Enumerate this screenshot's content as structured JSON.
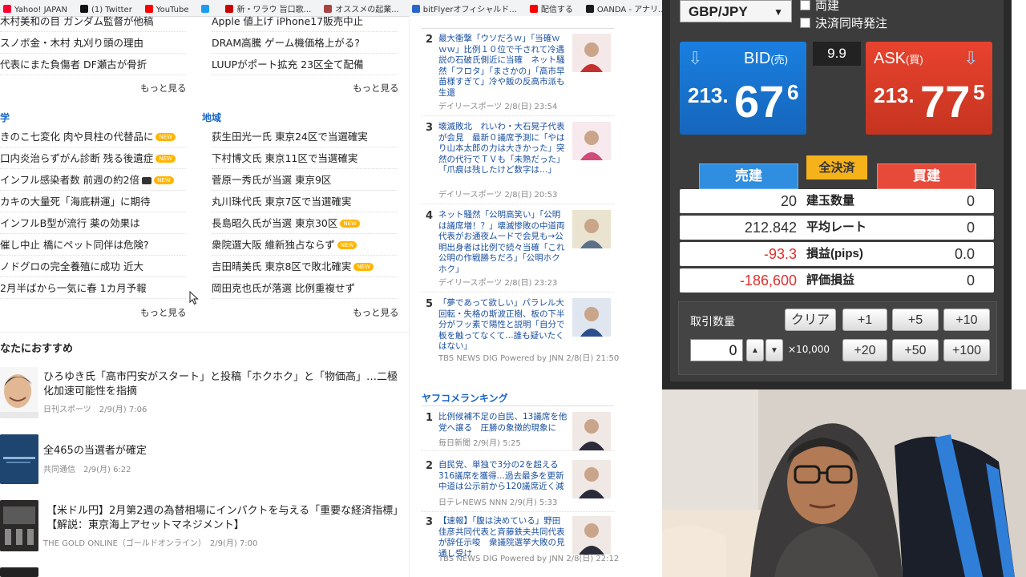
{
  "bookmarks": [
    {
      "label": "Yahoo! JAPAN",
      "color": "#ff0033"
    },
    {
      "label": "(1) Twitter",
      "color": "#111111"
    },
    {
      "label": "YouTube",
      "color": "#ff0000"
    },
    {
      "label": "",
      "color": "#1d9bf0"
    },
    {
      "label": "新・ワラウ 旨口歌...",
      "color": "#cc0000"
    },
    {
      "label": "オススメの起業...",
      "color": "#aa4444"
    },
    {
      "label": "bitFlyerオフィシャルド...",
      "color": "#2a66c8"
    },
    {
      "label": "配信する",
      "color": "#ff0000"
    },
    {
      "label": "OANDA - アナリ...",
      "color": "#1a1a1a"
    }
  ],
  "news_left": {
    "top_items": [
      "木村美和の目 ガンダム監督が他稿",
      "スノボ金・木村 丸刈り頭の理由",
      "代表にまた負傷者 DF瀬古が骨折"
    ],
    "more": "もっと見る",
    "section_title": "学",
    "items": [
      {
        "text": "きのこ七変化 肉や貝柱の代替品に",
        "badge": "NEW",
        "video": false
      },
      {
        "text": "口内炎治らずがん診断 残る後遺症",
        "badge": "NEW",
        "video": false
      },
      {
        "text": "インフル感染者数 前週の約2倍",
        "badge": "NEW",
        "video": true
      },
      {
        "text": "カキの大量死「海底耕運」に期待",
        "badge": "",
        "video": false
      },
      {
        "text": "インフルB型が流行 薬の効果は",
        "badge": "",
        "video": false
      },
      {
        "text": "催し中止 橋にペット同伴は危険?",
        "badge": "",
        "video": false
      },
      {
        "text": "ノドグロの完全養殖に成功 近大",
        "badge": "",
        "video": false
      },
      {
        "text": "2月半ばから一気に春 1カ月予報",
        "badge": "",
        "video": false
      }
    ]
  },
  "news_right": {
    "top_items": [
      "Apple 値上げ iPhone17販売中止",
      "DRAM高騰 ゲーム機価格上がる?",
      "LUUPがポート拡充 23区全て配備"
    ],
    "more": "もっと見る",
    "section_title": "地域",
    "items": [
      {
        "text": "荻生田光一氏 東京24区で当選確実",
        "badge": ""
      },
      {
        "text": "下村博文氏 東京11区で当選確実",
        "badge": ""
      },
      {
        "text": "菅原一秀氏が当選 東京9区",
        "badge": ""
      },
      {
        "text": "丸川珠代氏 東京7区で当選確実",
        "badge": ""
      },
      {
        "text": "長島昭久氏が当選 東京30区",
        "badge": "NEW"
      },
      {
        "text": "衆院選大阪 維新独占ならず",
        "badge": "NEW"
      },
      {
        "text": "吉田晴美氏 東京8区で敗北確実",
        "badge": "NEW"
      },
      {
        "text": "岡田克也氏が落選 比例重複せず",
        "badge": ""
      }
    ]
  },
  "recommend": {
    "title": "なたにおすすめ",
    "items": [
      {
        "title": "ひろゆき氏「高市円安がスタート」と投稿「ホクホク」と「物価高」…二極化加速可能性を指摘",
        "meta": "日刊スポーツ　2/9(月) 7:06"
      },
      {
        "title": "全465の当選者が確定",
        "meta": "共同通信　2/9(月) 6:22"
      },
      {
        "title": "【米ドル円】2月第2週の為替相場にインパクトを与える「重要な経済指標」【解説：東京海上アセットマネジメント】",
        "meta": "THE GOLD ONLINE（ゴールドオンライン）　2/9(月) 7:00"
      }
    ]
  },
  "ranking_top": [
    {
      "num": "2",
      "text": "最大衝撃「ウソだろｗ」「当確ｗｗｗ」比例１０位で千されて冷遇説の石破氏側近に当確　ネット騒然「フロタ」「まさかの」「高市早苗様すぎて」冷や飯の反高市派も生還",
      "meta": "デイリースポーツ 2/8(日) 23:54"
    },
    {
      "num": "3",
      "text": "壊滅敗北　れいわ・大石晃子代表が会見　最新０議席予測に「やはり山本太郎の力は大きかった」突然の代行でＴＶも「未熟だった」「爪痕は残したけど数字は…」",
      "meta": "デイリースポーツ 2/8(日) 20:53"
    },
    {
      "num": "4",
      "text": "ネット騒然「公明高笑い」「公明は議席増！？」壊滅惨敗の中道両代表がお通夜ムードで会見も→公明出身者は比例で続々当確「これ公明の作戦勝ちだろ」「公明ホクホク」",
      "meta": "デイリースポーツ 2/8(日) 23:23"
    },
    {
      "num": "5",
      "text": "「夢であって欲しい」パラレル大回転・失格の斯波正樹、板の下半分がフッ素で陽性と説明「自分で板を触ってなくて…誰も疑いたくはない」",
      "meta": "TBS NEWS DIG Powered by JNN 2/8(日) 21:50"
    }
  ],
  "yahoo_ranking": {
    "title": "ヤフコメランキング",
    "items": [
      {
        "num": "1",
        "text": "比例候補不足の自民、13議席を他党へ譲る　圧勝の象徴的現象に",
        "meta": "毎日新聞 2/9(月) 5:25"
      },
      {
        "num": "2",
        "text": "自民党、単独で3分の2を超える316議席を獲得…過去最多を更新　中道は公示前から120議席近く減",
        "meta": "日テレNEWS NNN 2/9(月) 5:33"
      },
      {
        "num": "3",
        "text": "【速報】「腹は決めている」野田佳彦共同代表と斉藤鉄夫共同代表が辞任示唆　衆議院選挙大敗の見通し受け",
        "meta": "TBS NEWS DIG Powered by JNN 2/8(日) 22:12"
      }
    ]
  },
  "trade": {
    "pair": "GBP/JPY",
    "checkbox1": "両建",
    "checkbox2": "決済同時発注",
    "bid_label": "BID",
    "bid_sub": "(売)",
    "ask_label": "ASK",
    "ask_sub": "(買)",
    "spread": "9.9",
    "bid_big": "213.",
    "bid_mid": "67",
    "bid_small": "6",
    "ask_big": "213.",
    "ask_mid": "77",
    "ask_small": "5",
    "tab_sell": "売建",
    "tab_all": "全決済",
    "tab_buy": "買建",
    "rows": [
      {
        "v1": "20",
        "label": "建玉数量",
        "v2": "0",
        "neg": false
      },
      {
        "v1": "212.842",
        "label": "平均レート",
        "v2": "0",
        "neg": false
      },
      {
        "v1": "-93.3",
        "label": "損益(pips)",
        "v2": "0.0",
        "neg": true
      },
      {
        "v1": "-186,600",
        "label": "評価損益",
        "v2": "0",
        "neg": true
      }
    ],
    "qty_label": "取引数量",
    "qty_value": "0",
    "unit": "×10,000",
    "btn_clear": "クリア",
    "btn_p1": "+1",
    "btn_p5": "+5",
    "btn_p10": "+10",
    "btn_p20": "+20",
    "btn_p50": "+50",
    "btn_p100": "+100",
    "bid_color": "#1a7fe0",
    "ask_color": "#e8432e"
  }
}
